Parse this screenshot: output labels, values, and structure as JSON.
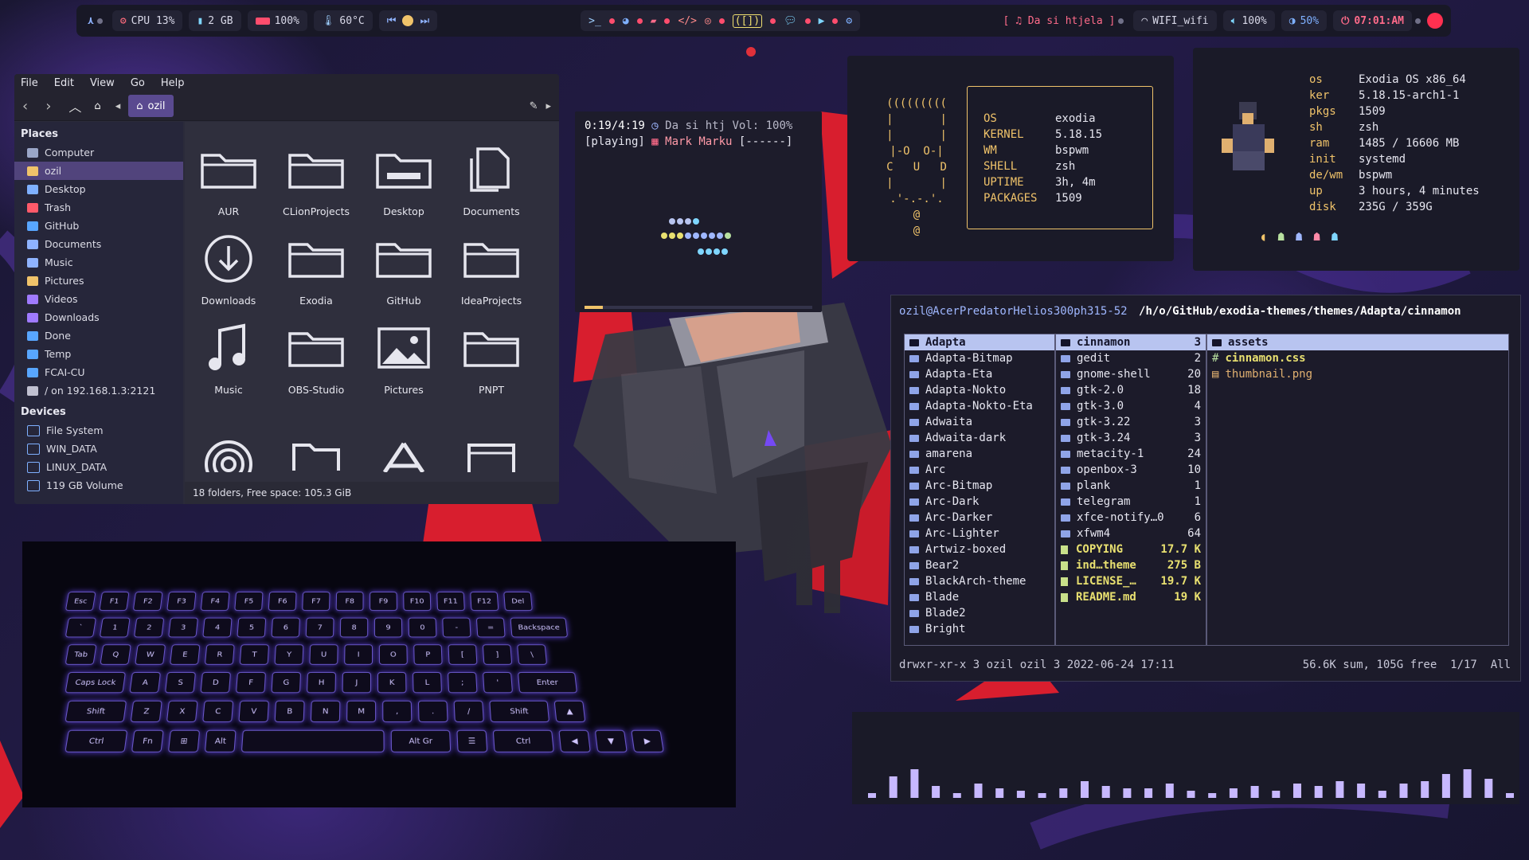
{
  "topbar": {
    "cpu": "CPU 13%",
    "ram": "2 GB",
    "battery": "100%",
    "temp": "60°C",
    "now_playing": "[ ♫ Da si htjela ]",
    "wifi": "WIFI_wifi",
    "volume": "100%",
    "brightness": "50%",
    "clock": "07:01:AM"
  },
  "filemanager": {
    "menu": [
      "File",
      "Edit",
      "View",
      "Go",
      "Help"
    ],
    "location": "ozil",
    "places_header": "Places",
    "places": [
      "Computer",
      "ozil",
      "Desktop",
      "Trash",
      "GitHub",
      "Documents",
      "Music",
      "Pictures",
      "Videos",
      "Downloads",
      "Done",
      "Temp",
      "FCAI-CU",
      "/ on 192.168.1.3:2121"
    ],
    "devices_header": "Devices",
    "devices": [
      "File System",
      "WIN_DATA",
      "LINUX_DATA",
      "119 GB Volume"
    ],
    "items": [
      "AUR",
      "CLionProjects",
      "Desktop",
      "Documents",
      "Downloads",
      "Exodia",
      "GitHub",
      "IdeaProjects",
      "Music",
      "OBS-Studio",
      "Pictures",
      "PNPT"
    ],
    "status": "18 folders, Free space: 105.3 GiB"
  },
  "player": {
    "line1_time": "0:19/4:19",
    "line1_rest": "Da si htj Vol: 100%",
    "line2_state": "[playing]",
    "line2_artist": "Mark Marku",
    "line2_flags": "[------]",
    "progress": 0.08
  },
  "pfetch": {
    "ascii": [
      "(((((((((",
      "|       |",
      "|       |",
      "|-O  O-|",
      "C   U   D",
      "|       |",
      ".'-.-.'.",
      "@",
      "@"
    ],
    "rows": [
      [
        "OS",
        "exodia"
      ],
      [
        "KERNEL",
        "5.18.15"
      ],
      [
        "WM",
        "bspwm"
      ],
      [
        "SHELL",
        "zsh"
      ],
      [
        "UPTIME",
        "3h, 4m"
      ],
      [
        "PACKAGES",
        "1509"
      ]
    ]
  },
  "neofetch": {
    "rows": [
      [
        "os",
        "Exodia OS x86_64"
      ],
      [
        "ker",
        "5.18.15-arch1-1"
      ],
      [
        "pkgs",
        "1509"
      ],
      [
        "sh",
        "zsh"
      ],
      [
        "ram",
        "1485 / 16606 MB"
      ],
      [
        "init",
        "systemd"
      ],
      [
        "de/wm",
        "bspwm"
      ],
      [
        "up",
        "3 hours, 4 minutes"
      ],
      [
        "disk",
        "235G / 359G"
      ]
    ]
  },
  "ranger": {
    "header_host": "ozil@AcerPredatorHelios300ph315-52",
    "header_path": "/h/o/GitHub/exodia-themes/themes/Adapta/cinnamon",
    "col1": [
      "Adapta",
      "Adapta-Bitmap",
      "Adapta-Eta",
      "Adapta-Nokto",
      "Adapta-Nokto-Eta",
      "Adwaita",
      "Adwaita-dark",
      "amarena",
      "Arc",
      "Arc-Bitmap",
      "Arc-Dark",
      "Arc-Darker",
      "Arc-Lighter",
      "Artwiz-boxed",
      "Bear2",
      "BlackArch-theme",
      "Blade",
      "Blade2",
      "Bright"
    ],
    "col2": [
      {
        "name": "cinnamon",
        "size": "3",
        "type": "dir"
      },
      {
        "name": "gedit",
        "size": "2",
        "type": "dir"
      },
      {
        "name": "gnome-shell",
        "size": "20",
        "type": "dir"
      },
      {
        "name": "gtk-2.0",
        "size": "18",
        "type": "dir"
      },
      {
        "name": "gtk-3.0",
        "size": "4",
        "type": "dir"
      },
      {
        "name": "gtk-3.22",
        "size": "3",
        "type": "dir"
      },
      {
        "name": "gtk-3.24",
        "size": "3",
        "type": "dir"
      },
      {
        "name": "metacity-1",
        "size": "24",
        "type": "dir"
      },
      {
        "name": "openbox-3",
        "size": "10",
        "type": "dir"
      },
      {
        "name": "plank",
        "size": "1",
        "type": "dir"
      },
      {
        "name": "telegram",
        "size": "1",
        "type": "dir"
      },
      {
        "name": "xfce-notify…0",
        "size": "6",
        "type": "dir"
      },
      {
        "name": "xfwm4",
        "size": "64",
        "type": "dir"
      },
      {
        "name": "COPYING",
        "size": "17.7 K",
        "type": "file"
      },
      {
        "name": "ind…theme",
        "size": "275 B",
        "type": "file"
      },
      {
        "name": "LICENSE_…",
        "size": "19.7 K",
        "type": "file"
      },
      {
        "name": "README.md",
        "size": "19 K",
        "type": "file"
      }
    ],
    "col3": [
      {
        "name": "assets",
        "type": "dir"
      },
      {
        "name": "cinnamon.css",
        "type": "css"
      },
      {
        "name": "thumbnail.png",
        "type": "img"
      }
    ],
    "status_left": "drwxr-xr-x 3 ozil ozil 3 2022-06-24 17:11",
    "status_right": "56.6K sum, 105G free  1/17  All"
  },
  "keyboard_rows": [
    [
      "Esc",
      "F1",
      "F2",
      "F3",
      "F4",
      "F5",
      "F6",
      "F7",
      "F8",
      "F9",
      "F10",
      "F11",
      "F12",
      "Del"
    ],
    [
      "`",
      "1",
      "2",
      "3",
      "4",
      "5",
      "6",
      "7",
      "8",
      "9",
      "0",
      "-",
      "=",
      "Backspace"
    ],
    [
      "Tab",
      "Q",
      "W",
      "E",
      "R",
      "T",
      "Y",
      "U",
      "I",
      "O",
      "P",
      "[",
      "]",
      "\\"
    ],
    [
      "Caps Lock",
      "A",
      "S",
      "D",
      "F",
      "G",
      "H",
      "J",
      "K",
      "L",
      ";",
      "'",
      "Enter"
    ],
    [
      "Shift",
      "Z",
      "X",
      "C",
      "V",
      "B",
      "N",
      "M",
      ",",
      ".",
      "/",
      "Shift",
      "▲"
    ],
    [
      "Ctrl",
      "Fn",
      "⊞",
      "Alt",
      "",
      "Alt Gr",
      "☰",
      "Ctrl",
      "◀",
      "▼",
      "▶"
    ]
  ],
  "visualizer_levels": [
    0.1,
    0.45,
    0.6,
    0.25,
    0.1,
    0.3,
    0.2,
    0.15,
    0.1,
    0.2,
    0.35,
    0.25,
    0.2,
    0.2,
    0.3,
    0.15,
    0.1,
    0.2,
    0.25,
    0.15,
    0.3,
    0.25,
    0.35,
    0.3,
    0.15,
    0.3,
    0.35,
    0.5,
    0.6,
    0.4,
    0.1
  ],
  "colors": {
    "accent": "#5a4a90",
    "bar_bg": "#181826",
    "red": "#e0303a",
    "viz": "#c7b8ff"
  }
}
